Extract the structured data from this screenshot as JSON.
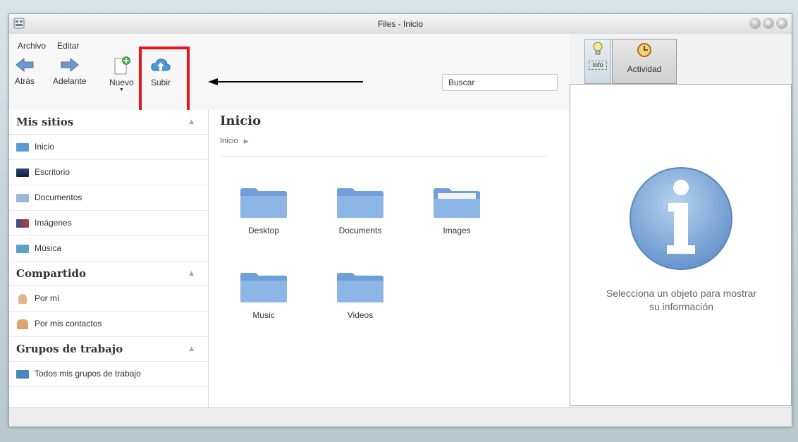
{
  "window": {
    "title": "Files - Inicio"
  },
  "menu": {
    "archivo": "Archivo",
    "editar": "Editar"
  },
  "toolbar": {
    "back_label": "Atrás",
    "forward_label": "Adelante",
    "new_label": "Nuevo",
    "upload_label": "Subir"
  },
  "search": {
    "placeholder": "Buscar"
  },
  "sidebar": {
    "sections": [
      {
        "title": "Mis sitios",
        "items": [
          "Inicio",
          "Escritorio",
          "Documentos",
          "Imágenes",
          "Música"
        ]
      },
      {
        "title": "Compartido",
        "items": [
          "Por mí",
          "Por mis contactos"
        ]
      },
      {
        "title": "Grupos de trabajo",
        "items": [
          "Todos mis grupos de trabajo"
        ]
      }
    ]
  },
  "main": {
    "title": "Inicio",
    "breadcrumb": "Inicio",
    "folders": [
      "Desktop",
      "Documents",
      "Images",
      "Music",
      "Videos"
    ]
  },
  "right_panel": {
    "tab_info": "Info",
    "tab_activity": "Actividad",
    "message_line1": "Selecciona un objeto para mostrar",
    "message_line2": "su información"
  },
  "colors": {
    "highlight": "#e8141a",
    "folder": "#7fa8d8",
    "info_icon": "#7fa8d8"
  }
}
